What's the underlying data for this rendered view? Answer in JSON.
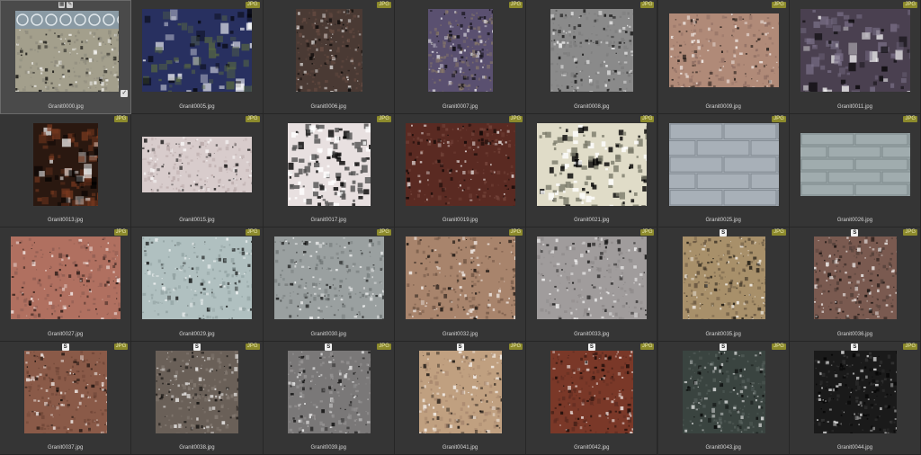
{
  "badge_text": "JPG",
  "s_badge_text": "S",
  "selected_icons": [
    "grid-icon",
    "edit-icon"
  ],
  "check_icon": "check-icon",
  "items": [
    {
      "name": "Granit0000.jpg",
      "c1": "#a39f8c",
      "c2": "#8a877a",
      "selected": true,
      "pattern": "wave"
    },
    {
      "name": "Granit0005.jpg",
      "c1": "#283060",
      "c2": "#5a6a40",
      "pattern": "crystal"
    },
    {
      "name": "Granit0006.jpg",
      "c1": "#4a3a34",
      "c2": "#6a4e44"
    },
    {
      "name": "Granit0007.jpg",
      "c1": "#5a5070",
      "c2": "#8a7a68"
    },
    {
      "name": "Granit0008.jpg",
      "c1": "#8a8a8a",
      "c2": "#7a7a7a"
    },
    {
      "name": "Granit0009.jpg",
      "c1": "#b08a78",
      "c2": "#8a6a60"
    },
    {
      "name": "Granit0011.jpg",
      "c1": "#4a4050",
      "c2": "#7a7088",
      "pattern": "crystal"
    },
    {
      "name": "Granit0013.jpg",
      "c1": "#2a1810",
      "c2": "#7a3a20",
      "pattern": "crystal"
    },
    {
      "name": "Granit0015.jpg",
      "c1": "#d8cccc",
      "c2": "#b8a8a8"
    },
    {
      "name": "Granit0017.jpg",
      "c1": "#e8e0e0",
      "c2": "#505050",
      "pattern": "speck"
    },
    {
      "name": "Granit0019.jpg",
      "c1": "#5a2a22",
      "c2": "#7a4a40"
    },
    {
      "name": "Granit0021.jpg",
      "c1": "#e0dcc8",
      "c2": "#7a7a6a",
      "pattern": "speck"
    },
    {
      "name": "Granit0025.jpg",
      "c1": "#a8b0b8",
      "c2": "#808890",
      "pattern": "brick"
    },
    {
      "name": "Granit0026.jpg",
      "c1": "#a0acae",
      "c2": "#7a8688",
      "pattern": "brick"
    },
    {
      "name": "Granit0027.jpg",
      "c1": "#b07060",
      "c2": "#8a5a50"
    },
    {
      "name": "Granit0029.jpg",
      "c1": "#b0c0c0",
      "c2": "#8a9a9a"
    },
    {
      "name": "Granit0030.jpg",
      "c1": "#9aa0a0",
      "c2": "#6a7070"
    },
    {
      "name": "Granit0032.jpg",
      "c1": "#a8846c",
      "c2": "#6a5040"
    },
    {
      "name": "Granit0033.jpg",
      "c1": "#a09c9c",
      "c2": "#8a8686"
    },
    {
      "name": "Granit0035.jpg",
      "c1": "#a8906a",
      "c2": "#5a4a38",
      "s": true
    },
    {
      "name": "Granit0036.jpg",
      "c1": "#7a5a50",
      "c2": "#4a3a34",
      "s": true
    },
    {
      "name": "Granit0037.jpg",
      "c1": "#8a5a48",
      "c2": "#6a4234",
      "s": true
    },
    {
      "name": "Granit0038.jpg",
      "c1": "#6a6058",
      "c2": "#8a8078",
      "s": true
    },
    {
      "name": "Granit0039.jpg",
      "c1": "#7a7878",
      "c2": "#9a9898",
      "s": true
    },
    {
      "name": "Granit0041.jpg",
      "c1": "#c0a080",
      "c2": "#a08068",
      "s": true
    },
    {
      "name": "Granit0042.jpg",
      "c1": "#7a3828",
      "c2": "#5a2a20",
      "s": true
    },
    {
      "name": "Granit0043.jpg",
      "c1": "#3a4440",
      "c2": "#5a6460",
      "s": true
    },
    {
      "name": "Granit0044.jpg",
      "c1": "#1a1a1a",
      "c2": "#3a3a3a",
      "s": true
    }
  ]
}
